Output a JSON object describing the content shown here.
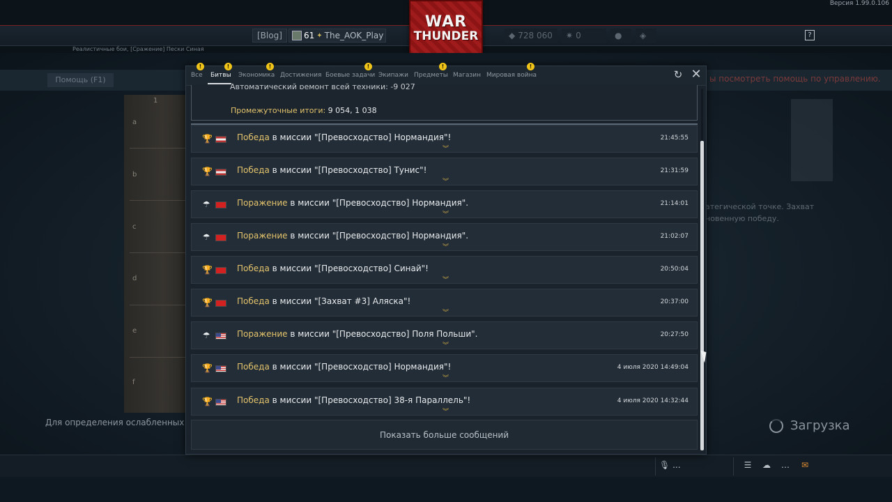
{
  "app": {
    "version": "Версия 1.99.0.106",
    "logo_line1": "WAR",
    "logo_line2": "THUNDER"
  },
  "header": {
    "blog": "[Blog]",
    "player_level": "61",
    "player_name": "The_AOK_Play",
    "silver_lions": "728 060",
    "golden_eagles": "0",
    "help_icon": "question-icon"
  },
  "background": {
    "mode_line": "Реалистичные бои, [Сражение] Пески Синая",
    "help_f1": "Помощь (F1)",
    "right_hint": "ы посмотреть помощь по управлению.",
    "map_letters": [
      "a",
      "b",
      "c",
      "d",
      "e",
      "f"
    ],
    "map_number": "1",
    "side_text_1": "атегической точке. Захват",
    "side_text_2": "новенную победу.",
    "bottom_text": "Для определения ослабленных мест",
    "loading": "Загрузка",
    "mic_label": "..."
  },
  "window": {
    "tabs": [
      {
        "label": "Все",
        "badge": "!"
      },
      {
        "label": "Битвы",
        "badge": "!",
        "active": true
      },
      {
        "label": "Экономика",
        "badge": "!"
      },
      {
        "label": "Достижения"
      },
      {
        "label": "Боевые задачи",
        "badge": "!"
      },
      {
        "label": "Экипажи"
      },
      {
        "label": "Предметы",
        "badge": "!"
      },
      {
        "label": "Магазин"
      },
      {
        "label": "Мировая война",
        "badge": "!"
      }
    ],
    "summary_cut_text": "Автоматический ремонт всей техники: -9 027",
    "summary_label": "Промежуточные итоги:",
    "summary_value": "9 054, 1 038",
    "messages": [
      {
        "icon": "trophy-icon",
        "flag": "de",
        "result": "Победа",
        "text": " в миссии \"[Превосходство] Нормандия\"!",
        "time": "21:45:55"
      },
      {
        "icon": "trophy-icon",
        "flag": "de",
        "result": "Победа",
        "text": " в миссии \"[Превосходство] Тунис\"!",
        "time": "21:31:59"
      },
      {
        "icon": "parachute-icon",
        "flag": "cn",
        "result": "Поражение",
        "text": " в миссии \"[Превосходство] Нормандия\".",
        "time": "21:14:01"
      },
      {
        "icon": "parachute-icon",
        "flag": "cn",
        "result": "Поражение",
        "text": " в миссии \"[Превосходство] Нормандия\".",
        "time": "21:02:07"
      },
      {
        "icon": "trophy-icon",
        "flag": "cn",
        "result": "Победа",
        "text": " в миссии \"[Превосходство] Синай\"!",
        "time": "20:50:04"
      },
      {
        "icon": "trophy-icon",
        "flag": "cn",
        "result": "Победа",
        "text": " в миссии \"[Захват #3] Аляска\"!",
        "time": "20:37:00"
      },
      {
        "icon": "parachute-icon",
        "flag": "us",
        "result": "Поражение",
        "text": " в миссии \"[Превосходство] Поля Польши\".",
        "time": "20:27:50"
      },
      {
        "icon": "trophy-icon",
        "flag": "us",
        "result": "Победа",
        "text": " в миссии \"[Превосходство] Нормандия\"!",
        "time": "4 июля 2020 14:49:04"
      },
      {
        "icon": "trophy-icon",
        "flag": "us",
        "result": "Победа",
        "text": " в миссии \"[Превосходство] 38-я Параллель\"!",
        "time": "4 июля 2020 14:32:44"
      }
    ],
    "show_more": "Показать больше сообщений"
  },
  "colors": {
    "accent_gold": "#e3c36b",
    "badge_yellow": "#f0c419",
    "mail_orange": "#e08c32"
  }
}
